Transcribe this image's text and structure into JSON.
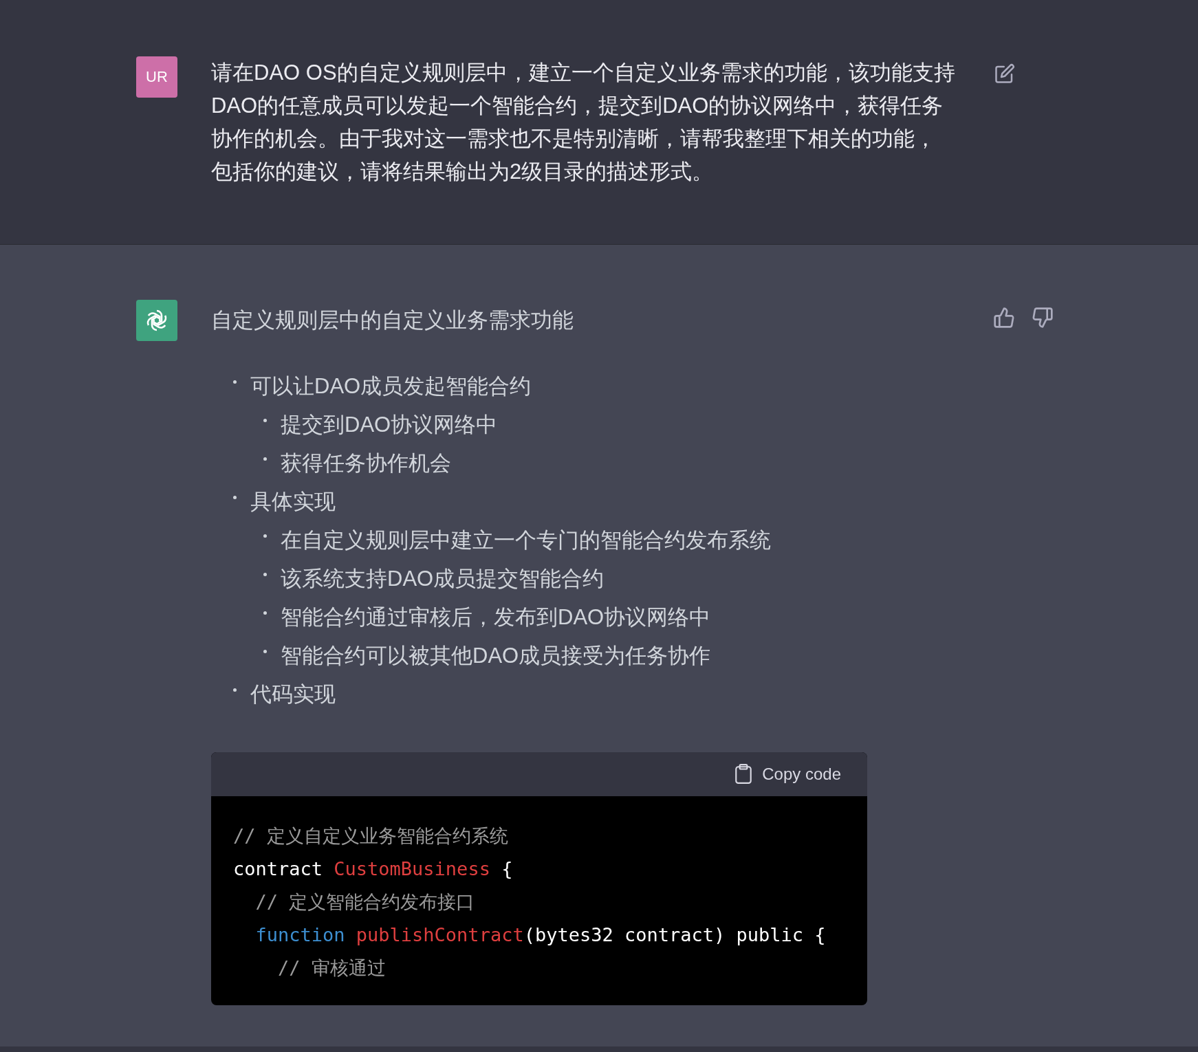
{
  "user_message": {
    "avatar": "UR",
    "lines": [
      "请在DAO OS的自定义规则层中，建立一个自定义业务需求的功能，该功能支持",
      "DAO的任意成员可以发起一个智能合约，提交到DAO的协议网络中，获得任务",
      "协作的机会。由于我对这一需求也不是特别清晰，请帮我整理下相关的功能，",
      "包括你的建议，请将结果输出为2级目录的描述形式。"
    ]
  },
  "assistant_message": {
    "heading": "自定义规则层中的自定义业务需求功能",
    "items": [
      {
        "text": "可以让DAO成员发起智能合约",
        "children": [
          {
            "text": "提交到DAO协议网络中"
          },
          {
            "text": "获得任务协作机会"
          }
        ]
      },
      {
        "text": "具体实现",
        "children": [
          {
            "text": "在自定义规则层中建立一个专门的智能合约发布系统"
          },
          {
            "text": "该系统支持DAO成员提交智能合约"
          },
          {
            "text": "智能合约通过审核后，发布到DAO协议网络中"
          },
          {
            "text": "智能合约可以被其他DAO成员接受为任务协作"
          }
        ]
      },
      {
        "text": "代码实现"
      }
    ],
    "code_block": {
      "copy_label": "Copy code",
      "lines": [
        [
          {
            "kind": "comment",
            "text": "// 定义自定义业务智能合约系统"
          }
        ],
        [
          {
            "kind": "plain",
            "text": "contract "
          },
          {
            "kind": "name",
            "text": "CustomBusiness"
          },
          {
            "kind": "plain",
            "text": " {"
          }
        ],
        [
          {
            "kind": "comment",
            "text": "  // 定义智能合约发布接口"
          }
        ],
        [
          {
            "kind": "keyword",
            "text": "  function"
          },
          {
            "kind": "name",
            "text": " publishContract"
          },
          {
            "kind": "plain",
            "text": "(bytes32 contract) public {"
          }
        ],
        [
          {
            "kind": "comment",
            "text": "    // 审核通过"
          }
        ]
      ]
    }
  }
}
